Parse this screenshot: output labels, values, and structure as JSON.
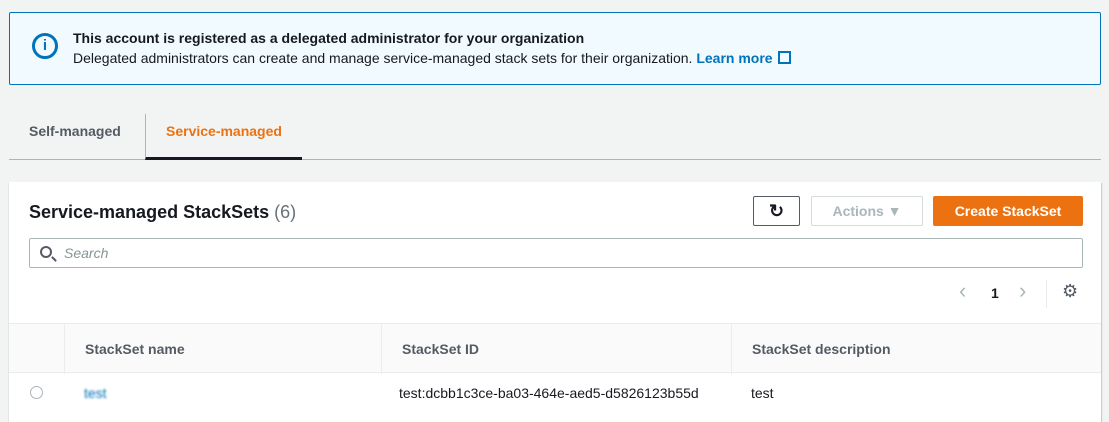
{
  "alert": {
    "title": "This account is registered as a delegated administrator for your organization",
    "body": "Delegated administrators can create and manage service-managed stack sets for their organization.",
    "link": "Learn more"
  },
  "tabs": [
    {
      "label": "Self-managed"
    },
    {
      "label": "Service-managed"
    }
  ],
  "panel": {
    "title": "Service-managed StackSets",
    "count": "(6)",
    "refresh": "↻",
    "actions": "Actions ▼",
    "create": "Create StackSet",
    "search_placeholder": "Search",
    "page": "1",
    "prev": "‹",
    "next": "›",
    "settings": "⚙"
  },
  "table": {
    "columns": [
      "StackSet name",
      "StackSet ID",
      "StackSet description"
    ],
    "rows": [
      {
        "name": "test",
        "id": "test:dcbb1c3ce-ba03-464e-aed5-d5826123b55d",
        "description": "test"
      }
    ]
  }
}
